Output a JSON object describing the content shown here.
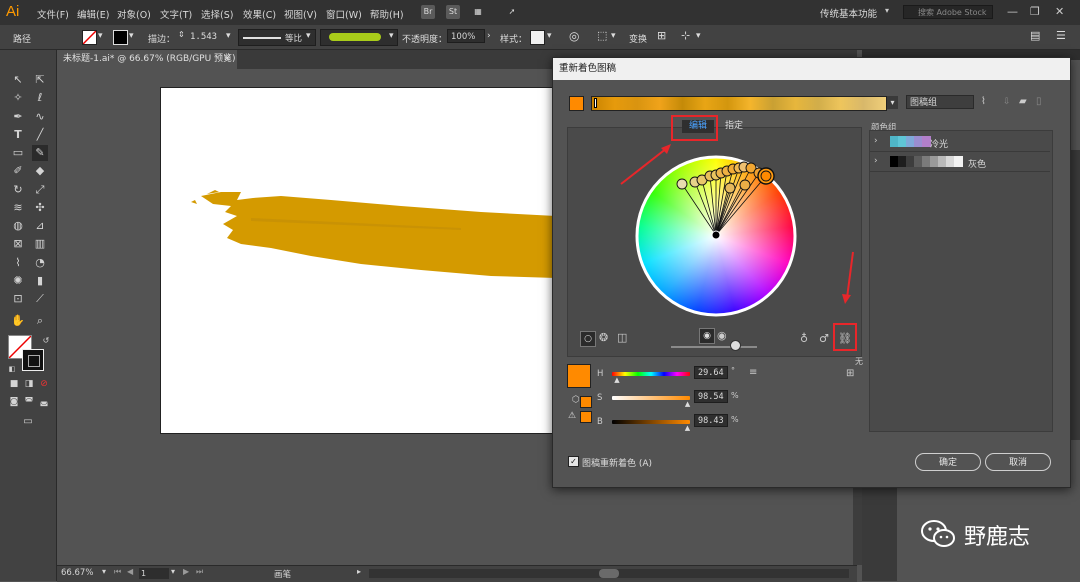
{
  "app": {
    "logo": "Ai"
  },
  "menu": {
    "items": [
      "文件(F)",
      "编辑(E)",
      "对象(O)",
      "文字(T)",
      "选择(S)",
      "效果(C)",
      "视图(V)",
      "窗口(W)",
      "帮助(H)"
    ],
    "icons": [
      "Br",
      "St"
    ],
    "workspace": "传统基本功能",
    "search_placeholder": "搜索 Adobe Stock"
  },
  "control_bar": {
    "object_type": "路径",
    "stroke_label": "描边：",
    "stroke_value": "1.543",
    "profile_label": "等比",
    "opacity_label": "不透明度：",
    "opacity_value": "100%",
    "style_label": "样式：",
    "transform_label": "变换"
  },
  "document": {
    "tab_title": "未标题-1.ai* @ 66.67% (RGB/GPU 预览)",
    "brush_color": "#d49a00"
  },
  "status_bar": {
    "zoom": "66.67%",
    "artboard_number": "1",
    "tool_name": "画笔"
  },
  "watermark": {
    "text": "野鹿志"
  },
  "dialog": {
    "title": "重新着色图稿",
    "group_name": "图稿组",
    "tabs": {
      "edit": "编辑",
      "assign": "指定"
    },
    "color_groups_label": "颜色组",
    "color_groups": [
      {
        "name": "冷光",
        "colors": [
          "#4fb6c8",
          "#5fc5d6",
          "#7fa8d8",
          "#9a8dd0",
          "#b27fca"
        ]
      },
      {
        "name": "灰色",
        "colors": [
          "#000000",
          "#1e1e1e",
          "#3d3d3d",
          "#5c5c5c",
          "#7b7b7b",
          "#9a9a9a",
          "#b9b9b9",
          "#d8d8d8",
          "#f2f2f2"
        ]
      }
    ],
    "sliders": [
      {
        "label": "H",
        "value": "29.64",
        "unit": "°",
        "fraction": 0.08
      },
      {
        "label": "S",
        "value": "98.54",
        "unit": "%",
        "fraction": 0.985
      },
      {
        "label": "B",
        "value": "98.43",
        "unit": "%",
        "fraction": 0.984
      }
    ],
    "none_label": "无",
    "recolor_checkbox_label": "图稿重新着色 (A)",
    "recolor_checked": true,
    "ok_label": "确定",
    "cancel_label": "取消",
    "base_color": "#ff8a00"
  }
}
